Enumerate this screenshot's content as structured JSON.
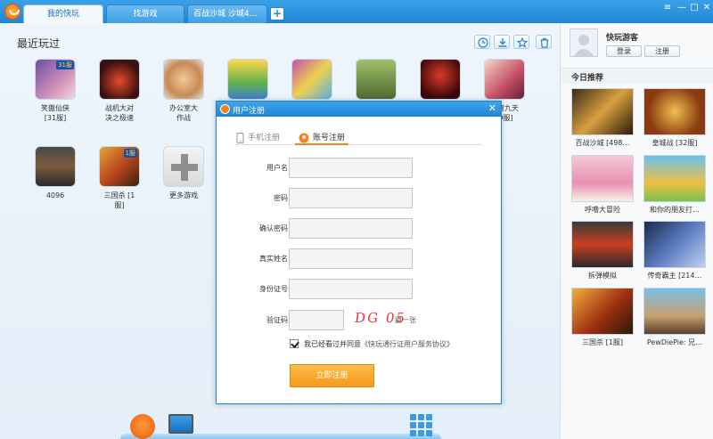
{
  "tabs": [
    {
      "label": "我的快玩"
    },
    {
      "label": "找游戏"
    },
    {
      "label": "百战沙城  沙城4…"
    }
  ],
  "main": {
    "section_title": "最近玩过",
    "games": [
      {
        "label": "笑傲仙侠\n[31服]",
        "badge": "31服"
      },
      {
        "label": "战机大对\n决之极速"
      },
      {
        "label": "办公室大\n作战"
      },
      {
        "label": ""
      },
      {
        "label": ""
      },
      {
        "label": ""
      },
      {
        "label": ""
      },
      {
        "label": "苍穹九天\n[9服]"
      },
      {
        "label": "4096"
      },
      {
        "label": "三国杀 [1\n服]",
        "badge": "1服"
      },
      {
        "label": "更多游戏"
      }
    ]
  },
  "side": {
    "nickname": "快玩游客",
    "login_label": "登录",
    "register_label": "注册",
    "today_title": "今日推荐",
    "recommended": [
      {
        "label": "百战沙城 [498…"
      },
      {
        "label": "皇城战 [32服]"
      },
      {
        "label": "呼噜大冒险"
      },
      {
        "label": "和你的朋友打…"
      },
      {
        "label": "拆弹模拟"
      },
      {
        "label": "传奇霸主 [214…"
      },
      {
        "label": "三国杀 [1服]"
      },
      {
        "label": "PewDiePie: 兄…"
      }
    ]
  },
  "dialog": {
    "title": "用户注册",
    "tab_phone": "手机注册",
    "tab_account": "账号注册",
    "fields": [
      {
        "label": "用户名"
      },
      {
        "label": "密码"
      },
      {
        "label": "确认密码"
      },
      {
        "label": "真实姓名"
      },
      {
        "label": "身份证号"
      },
      {
        "label": "验证码"
      }
    ],
    "captcha": "DG 05",
    "refresh_label": "换一张",
    "agree_prefix": "我已经看过并同意",
    "agree_link": "《快玩通行证用户服务协议》",
    "submit_label": "立即注册"
  },
  "colors": {
    "accent": "#1f86d6",
    "button": "#f49a1a"
  }
}
